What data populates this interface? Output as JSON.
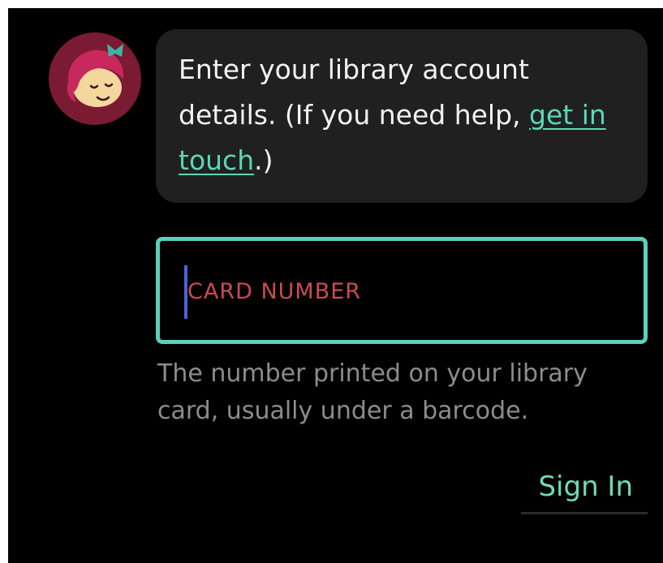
{
  "colors": {
    "background": "#000000",
    "bubble": "#202020",
    "accent": "#5ad8b4",
    "field_border": "#5ccfbd",
    "placeholder": "#cc4a50",
    "caret": "#4a64d8",
    "helper_text": "#8c8c8c"
  },
  "avatar": {
    "icon": "libby-mascot-icon"
  },
  "message": {
    "text_before_link": "Enter your library account details. (If you need help, ",
    "link_text": "get in touch",
    "text_after_link": ".)"
  },
  "card_field": {
    "label": "CARD NUMBER",
    "value": ""
  },
  "helper": {
    "text": "The number printed on your library card, usually under a barcode."
  },
  "actions": {
    "sign_in_label": "Sign In"
  }
}
